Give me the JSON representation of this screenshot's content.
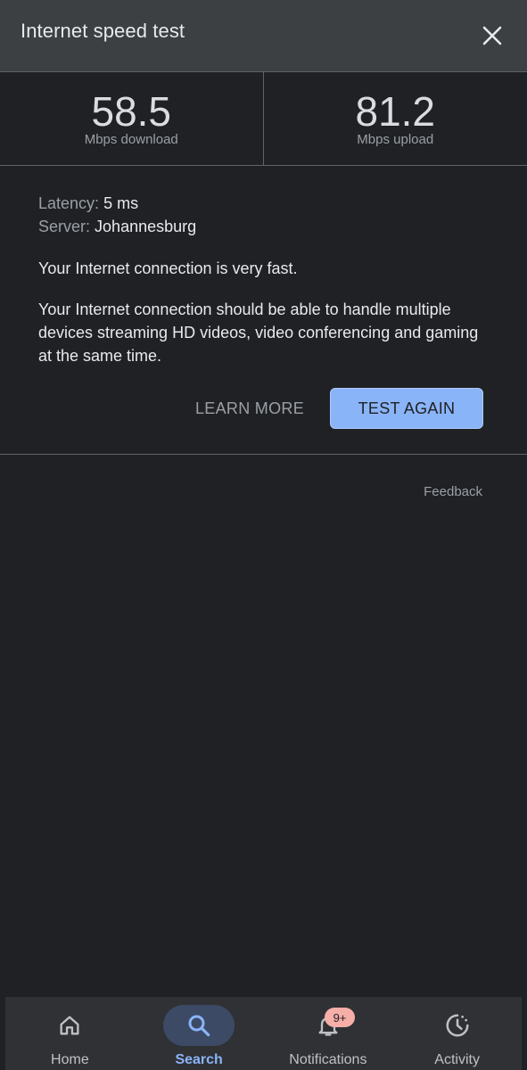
{
  "header": {
    "title": "Internet speed test",
    "close_icon": "close-icon"
  },
  "speeds": {
    "download": {
      "value": "58.5",
      "unit": "Mbps download"
    },
    "upload": {
      "value": "81.2",
      "unit": "Mbps upload"
    }
  },
  "details": {
    "latency_label": "Latency:",
    "latency_value": "5 ms",
    "server_label": "Server:",
    "server_value": "Johannesburg",
    "summary": "Your Internet connection is very fast.",
    "description": "Your Internet connection should be able to handle multiple devices streaming HD videos, video conferencing and gaming at the same time."
  },
  "actions": {
    "learn_more": "LEARN MORE",
    "test_again": "TEST AGAIN"
  },
  "feedback": "Feedback",
  "bottom_nav": {
    "items": [
      {
        "label": "Home",
        "icon": "home-icon"
      },
      {
        "label": "Search",
        "icon": "search-icon"
      },
      {
        "label": "Notifications",
        "icon": "bell-icon",
        "badge": "9+"
      },
      {
        "label": "Activity",
        "icon": "activity-icon"
      }
    ],
    "active": "Search"
  },
  "colors": {
    "accent": "#8ab4f8",
    "background": "#202124",
    "header": "#3c4043",
    "badge": "#f6aea9"
  }
}
